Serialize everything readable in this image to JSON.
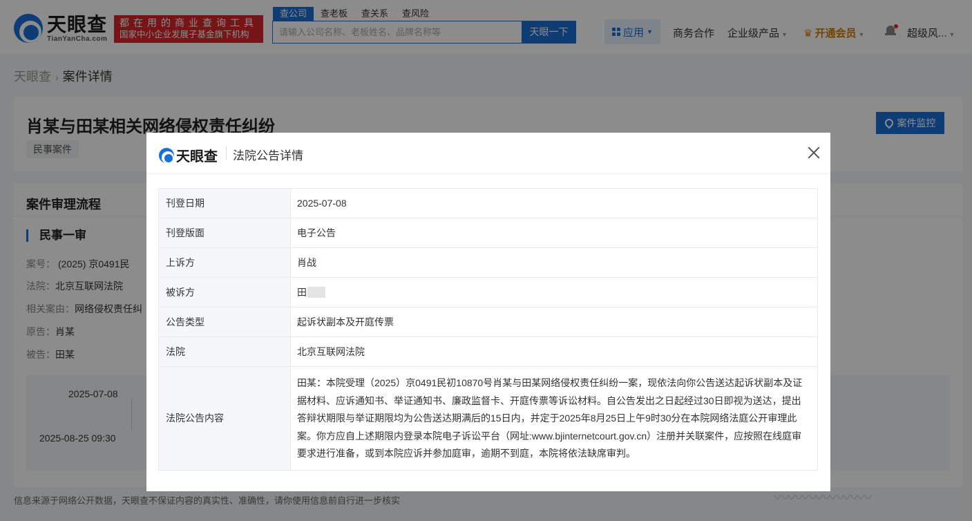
{
  "header": {
    "logo_cn": "天眼查",
    "logo_en": "TianYanCha.com",
    "slogan_line1": "都在用的商业查询工具",
    "slogan_line2": "国家中小企业发展子基金旗下机构",
    "search_tabs": [
      "查公司",
      "查老板",
      "查关系",
      "查风险"
    ],
    "search_placeholder": "请输入公司名称、老板姓名、品牌名称等",
    "search_button": "天眼一下",
    "nav_apps": "应用",
    "nav_business": "商务合作",
    "nav_enterprise": "企业级产品",
    "nav_vip": "开通会员",
    "nav_user": "超级风..."
  },
  "breadcrumb": {
    "home": "天眼查",
    "current": "案件详情"
  },
  "case": {
    "title": "肖某与田某相关网络侵权责任纠纷",
    "tag": "民事案件",
    "monitor_button": "案件监控"
  },
  "process": {
    "heading": "案件审理流程",
    "section_title": "民事一审",
    "case_no_label": "案号：",
    "case_no_value": "(2025) 京0491民",
    "court_label": "法院：",
    "court_value": "北京互联网法院",
    "cause_label": "相关案由：",
    "cause_value": "网络侵权责任纠",
    "plaintiff_label": "原告：",
    "plaintiff_value": "肖某",
    "defendant_label": "被告：",
    "defendant_value": "田某",
    "timeline_dates": [
      "2025-07-08",
      "2025-08-25 09:30"
    ]
  },
  "footer_note": "信息来源于网络公开数据，天眼查不保证内容的真实性、准确性，请你使用信息前自行进一步核实",
  "modal": {
    "logo_text": "天眼查",
    "title": "法院公告详情",
    "rows": [
      {
        "label": "刊登日期",
        "value": "2025-07-08"
      },
      {
        "label": "刊登版面",
        "value": "电子公告"
      },
      {
        "label": "上诉方",
        "value": "肖战"
      },
      {
        "label": "被诉方",
        "value": "田"
      },
      {
        "label": "公告类型",
        "value": "起诉状副本及开庭传票"
      },
      {
        "label": "法院",
        "value": "北京互联网法院"
      },
      {
        "label": "法院公告内容",
        "value": "田某：本院受理（2025）京0491民初10870号肖某与田某网络侵权责任纠纷一案，现依法向你公告送达起诉状副本及证据材料、应诉通知书、举证通知书、廉政监督卡、开庭传票等诉讼材料。自公告发出之日起经过30日即视为送达，提出答辩状期限与举证期限均为公告送达期满后的15日内，并定于2025年8月25日上午9时30分在本院网络法庭公开审理此案。你方应自上述期限内登录本院电子诉讼平台（网址:www.bjinternetcourt.gov.cn）注册并关联案件，应按照在线庭审要求进行准备，或到本院应诉并参加庭审，逾期不到庭，本院将依法缺席审判。"
      }
    ]
  },
  "colors": {
    "brand_blue": "#1b6fd8",
    "slogan_red": "#d7262a",
    "vip_gold": "#d37a00"
  }
}
